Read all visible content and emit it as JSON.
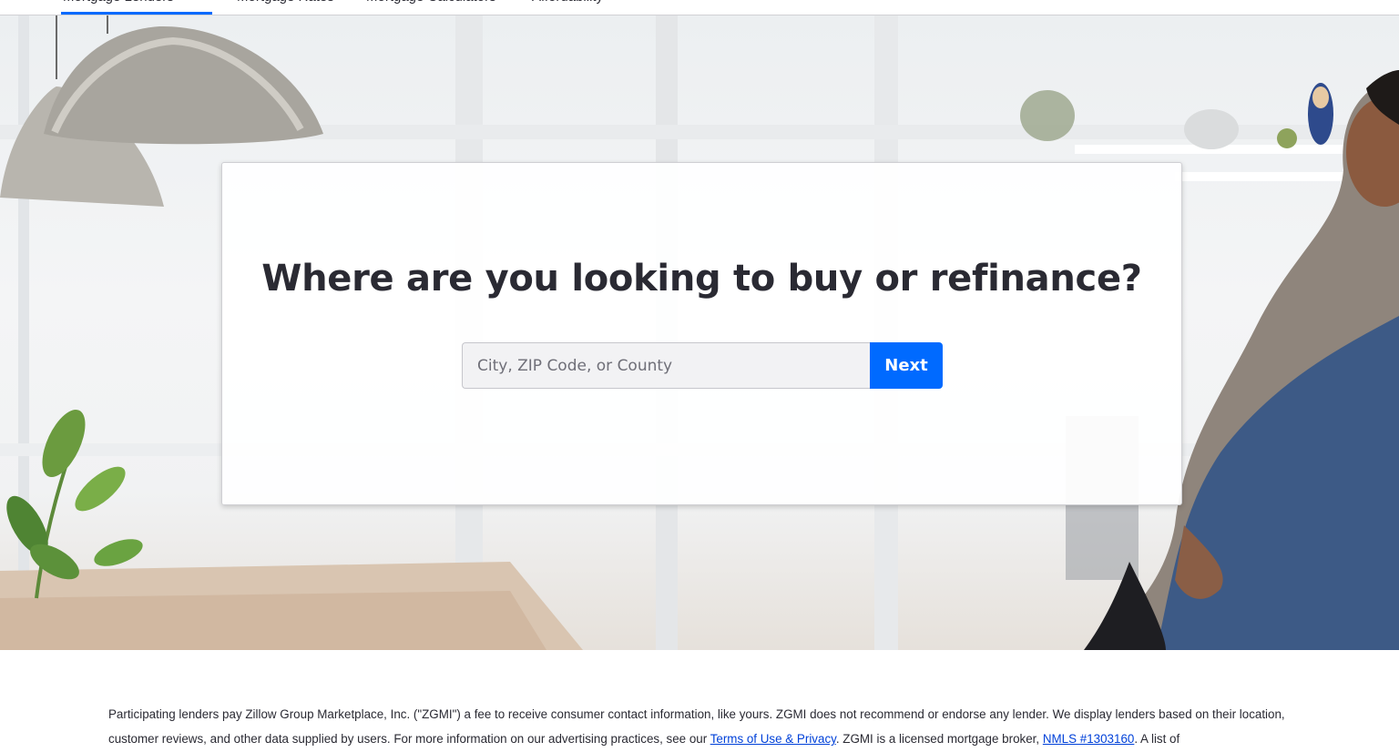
{
  "nav": {
    "tabs": [
      {
        "label": "Mortgage Lenders"
      },
      {
        "label": "Mortgage Rates"
      },
      {
        "label": "Mortgage Calculators"
      },
      {
        "label": "Affordability"
      }
    ]
  },
  "hero": {
    "heading": "Where are you looking to buy or refinance?",
    "search": {
      "placeholder": "City, ZIP Code, or County",
      "value": "",
      "button_label": "Next"
    }
  },
  "disclaimer": {
    "text_1": "Participating lenders pay Zillow Group Marketplace, Inc. (\"ZGMI\") a fee to receive consumer contact information, like yours. ZGMI does not recommend or endorse any lender. We display lenders based on their location, customer reviews, and other data supplied by users. For more information on our advertising practices, see our ",
    "link_terms": "Terms of Use & Privacy",
    "text_2": ". ZGMI is a licensed mortgage broker, ",
    "link_nmls": "NMLS #1303160",
    "text_3": ". A list of"
  },
  "colors": {
    "accent": "#006aff",
    "heading": "#2a2a33",
    "link": "#0041d9"
  }
}
